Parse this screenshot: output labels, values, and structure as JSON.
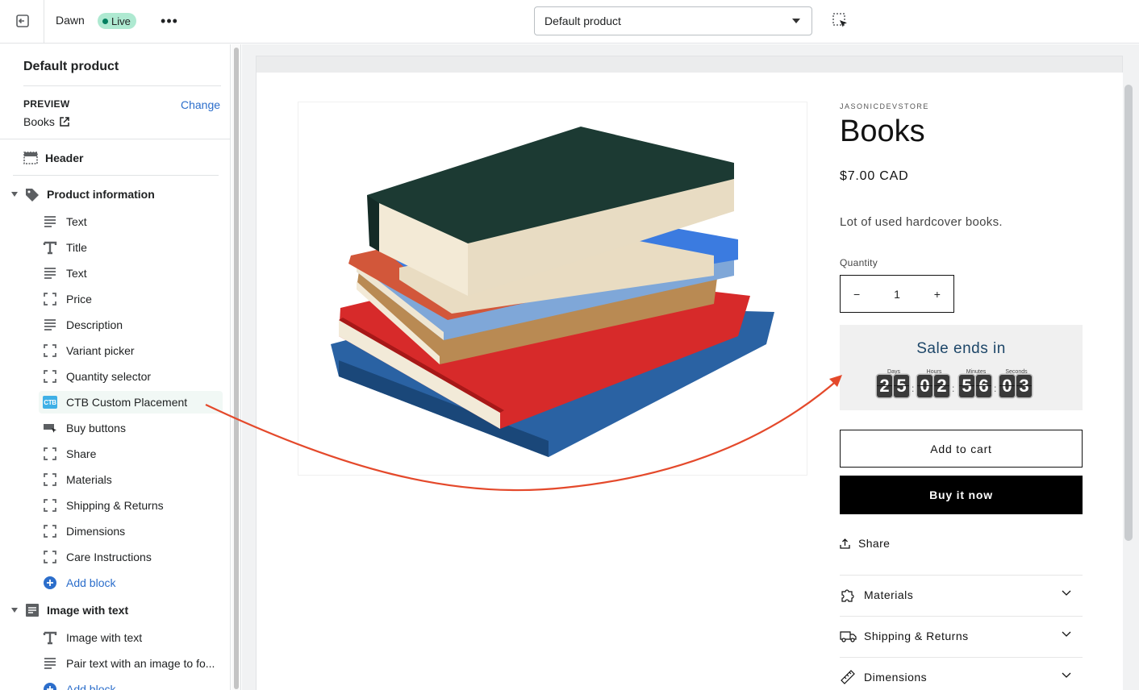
{
  "topbar": {
    "theme_name": "Dawn",
    "status_badge": "Live",
    "more_label": "•••",
    "template_selected": "Default product"
  },
  "sidebar": {
    "title": "Default product",
    "preview_label": "PREVIEW",
    "change_label": "Change",
    "preview_value": "Books",
    "header_section": "Header",
    "product_section": {
      "label": "Product information",
      "blocks": [
        {
          "label": "Text",
          "icon": "text-icon"
        },
        {
          "label": "Title",
          "icon": "title-icon"
        },
        {
          "label": "Text",
          "icon": "text-icon"
        },
        {
          "label": "Price",
          "icon": "block-icon"
        },
        {
          "label": "Description",
          "icon": "text-icon"
        },
        {
          "label": "Variant picker",
          "icon": "block-icon"
        },
        {
          "label": "Quantity selector",
          "icon": "block-icon"
        },
        {
          "label": "CTB Custom Placement",
          "icon": "ctb-app-icon",
          "icon_text": "CTB"
        },
        {
          "label": "Buy buttons",
          "icon": "buy-buttons-icon"
        },
        {
          "label": "Share",
          "icon": "block-icon"
        },
        {
          "label": "Materials",
          "icon": "block-icon"
        },
        {
          "label": "Shipping & Returns",
          "icon": "block-icon"
        },
        {
          "label": "Dimensions",
          "icon": "block-icon"
        },
        {
          "label": "Care Instructions",
          "icon": "block-icon"
        }
      ],
      "add_block": "Add block"
    },
    "image_section": {
      "label": "Image with text",
      "blocks": [
        {
          "label": "Image with text",
          "icon": "title-icon"
        },
        {
          "label": "Pair text with an image to fo...",
          "icon": "text-icon"
        }
      ],
      "add_block": "Add block"
    }
  },
  "product": {
    "vendor": "JASONICDEVSTORE",
    "title": "Books",
    "price": "$7.00 CAD",
    "description": "Lot of used hardcover books.",
    "quantity_label": "Quantity",
    "quantity_value": "1",
    "minus": "−",
    "plus": "+",
    "timer": {
      "title": "Sale ends in",
      "groups": [
        {
          "label": "Days",
          "digits": [
            "2",
            "5"
          ]
        },
        {
          "label": "Hours",
          "digits": [
            "0",
            "2"
          ]
        },
        {
          "label": "Minutes",
          "digits": [
            "5",
            "6"
          ]
        },
        {
          "label": "Seconds",
          "digits": [
            "0",
            "3"
          ]
        }
      ]
    },
    "add_to_cart": "Add to cart",
    "buy_now": "Buy it now",
    "share": "Share",
    "accordions": [
      {
        "label": "Materials",
        "icon": "puzzle-icon"
      },
      {
        "label": "Shipping & Returns",
        "icon": "truck-icon"
      },
      {
        "label": "Dimensions",
        "icon": "ruler-icon"
      }
    ]
  },
  "colors": {
    "accent_link": "#2c6ecb",
    "live_badge": "#aee9d1",
    "annotation_arrow": "#e4492b",
    "timer_title": "#1d4668"
  }
}
